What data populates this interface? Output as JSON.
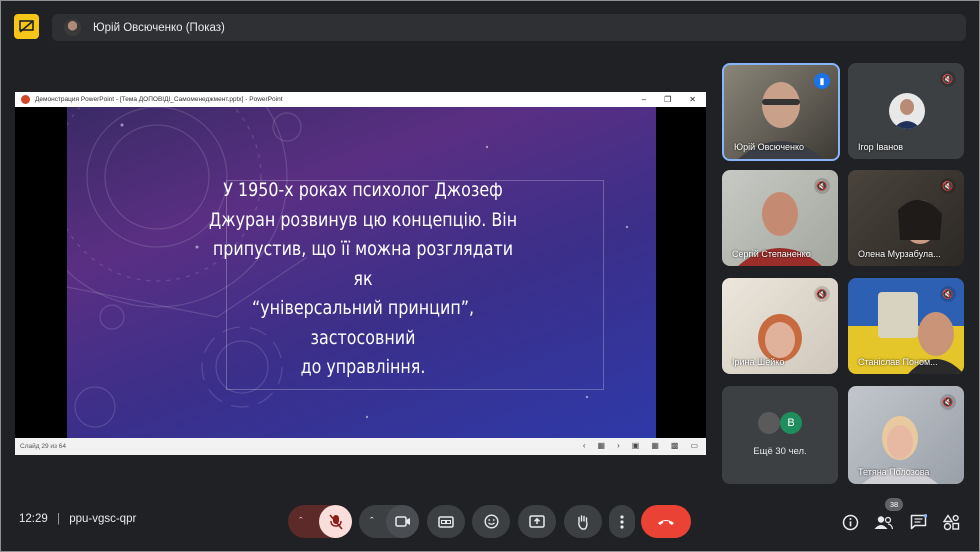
{
  "header": {
    "presenter": "Юрій Овсюченко (Показ)"
  },
  "presentation": {
    "window_title": "Демонстрация PowerPoint - [Тема ДОПОВІДІ_Самоменеджмент.pptx] - PowerPoint",
    "slide_lines": [
      "У 1950-х роках психолог Джозеф",
      "Джуран розвинув цю концепцію. Він",
      "припустив, що її можна розглядати як",
      "“універсальний принцип”, застосовний",
      "до управління."
    ],
    "slide_counter": "Слайд 29 из 64"
  },
  "participants": [
    {
      "name": "Юрій Овсюченко",
      "state": "speaking"
    },
    {
      "name": "Ігор Іванов",
      "state": "muted"
    },
    {
      "name": "Сергій Степаненко",
      "state": "muted"
    },
    {
      "name": "Олена Мурзабула...",
      "state": "muted"
    },
    {
      "name": "Ірина Шейко",
      "state": "muted"
    },
    {
      "name": "Станіслав Поном...",
      "state": "muted"
    },
    {
      "name": "Тетяна Полозова",
      "state": "muted"
    }
  ],
  "more_tile": {
    "label": "Ещё 30 чел.",
    "avatar_letter": "В"
  },
  "footer": {
    "time": "12:29",
    "separator": "|",
    "meeting_code": "ppu-vgsc-qpr",
    "people_count": "38"
  },
  "colors": {
    "present_badge": "#f5c518",
    "mic_off": "#f9dedc",
    "end_call": "#ea4335",
    "active_border": "#8ab4f8",
    "avatar_v": "#1e8e5e"
  }
}
